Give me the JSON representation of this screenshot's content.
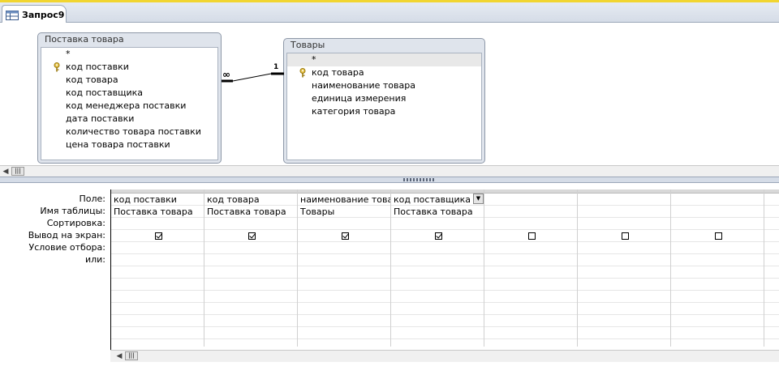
{
  "tab": {
    "title": "Запрос9"
  },
  "tables": [
    {
      "title": "Поставка товара",
      "fields": [
        {
          "name": "*",
          "key": false
        },
        {
          "name": "код поставки",
          "key": true
        },
        {
          "name": "код товара",
          "key": false
        },
        {
          "name": "код поставщика",
          "key": false
        },
        {
          "name": "код менеджера поставки",
          "key": false
        },
        {
          "name": "дата поставки",
          "key": false
        },
        {
          "name": "количество товара поставки",
          "key": false
        },
        {
          "name": "цена товара поставки",
          "key": false
        }
      ]
    },
    {
      "title": "Товары",
      "fields": [
        {
          "name": "*",
          "key": false
        },
        {
          "name": "код товара",
          "key": true
        },
        {
          "name": "наименование товара",
          "key": false
        },
        {
          "name": "единица измерения",
          "key": false
        },
        {
          "name": "категория товара",
          "key": false
        }
      ]
    }
  ],
  "relationship": {
    "many_label": "∞",
    "one_label": "1"
  },
  "grid": {
    "row_labels": [
      "Поле:",
      "Имя таблицы:",
      "Сортировка:",
      "Вывод на экран:",
      "Условие отбора:",
      "или:"
    ],
    "columns": [
      {
        "field": "код поставки",
        "table": "Поставка товара",
        "show": true
      },
      {
        "field": "код товара",
        "table": "Поставка товара",
        "show": true
      },
      {
        "field": "наименование товара",
        "table": "Товары",
        "show": true
      },
      {
        "field": "код поставщика",
        "table": "Поставка товара",
        "show": true,
        "dropdown": true
      },
      {
        "field": "",
        "table": "",
        "show": false
      },
      {
        "field": "",
        "table": "",
        "show": false
      },
      {
        "field": "",
        "table": "",
        "show": false
      },
      {
        "field": "",
        "table": "",
        "show": null
      }
    ]
  },
  "colors": {
    "tab_accent": "#f1d530",
    "panel_bg": "#dfe4ec"
  },
  "icons": {
    "tab": "query-icon",
    "key": "primary-key-icon"
  }
}
